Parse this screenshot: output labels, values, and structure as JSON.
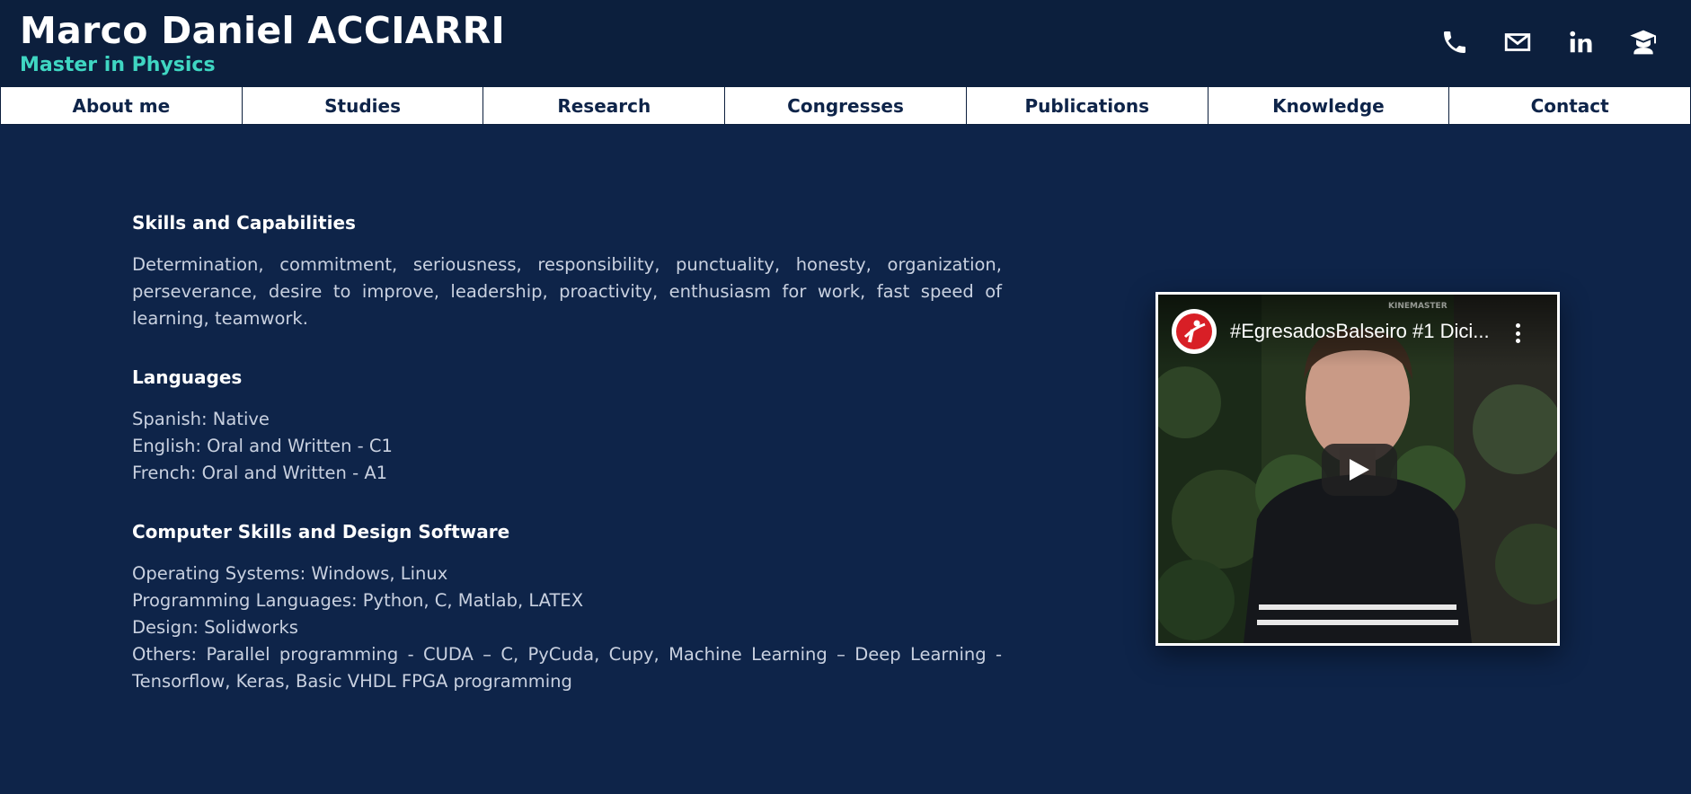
{
  "header": {
    "name": "Marco Daniel ACCIARRI",
    "subtitle": "Master in Physics",
    "icons": [
      "phone-icon",
      "mail-icon",
      "linkedin-icon",
      "graduate-icon"
    ]
  },
  "nav": {
    "items": [
      {
        "label": "About me"
      },
      {
        "label": "Studies"
      },
      {
        "label": "Research"
      },
      {
        "label": "Congresses"
      },
      {
        "label": "Publications"
      },
      {
        "label": "Knowledge"
      },
      {
        "label": "Contact"
      }
    ]
  },
  "sections": {
    "skills": {
      "title": "Skills and Capabilities",
      "body": "Determination, commitment, seriousness, responsibility, punctuality, honesty, organization, perseverance, desire to improve, leadership, proactivity, enthusiasm for work, fast speed of learning, teamwork."
    },
    "languages": {
      "title": "Languages",
      "lines": [
        "Spanish: Native",
        "English: Oral and Written - C1",
        "French: Oral and Written - A1"
      ]
    },
    "computer": {
      "title": "Computer Skills and Design Software",
      "lines": [
        "Operating Systems: Windows, Linux",
        "Programming Languages: Python, C, Matlab, LATEX",
        "Design: Solidworks",
        "Others: Parallel programming - CUDA – C, PyCuda, Cupy, Machine Learning – Deep Learning - Tensorflow, Keras, Basic VHDL FPGA programming"
      ]
    }
  },
  "video": {
    "title": "#EgresadosBalseiro #1 Dici...",
    "watermark": "KINEMASTER",
    "icons": [
      "channel-logo-icon",
      "more-vert-icon",
      "play-icon"
    ]
  },
  "colors": {
    "background": "#0e2449",
    "header": "#0c1f3d",
    "accent": "#3fd6c2",
    "nav_text": "#0e2449"
  }
}
